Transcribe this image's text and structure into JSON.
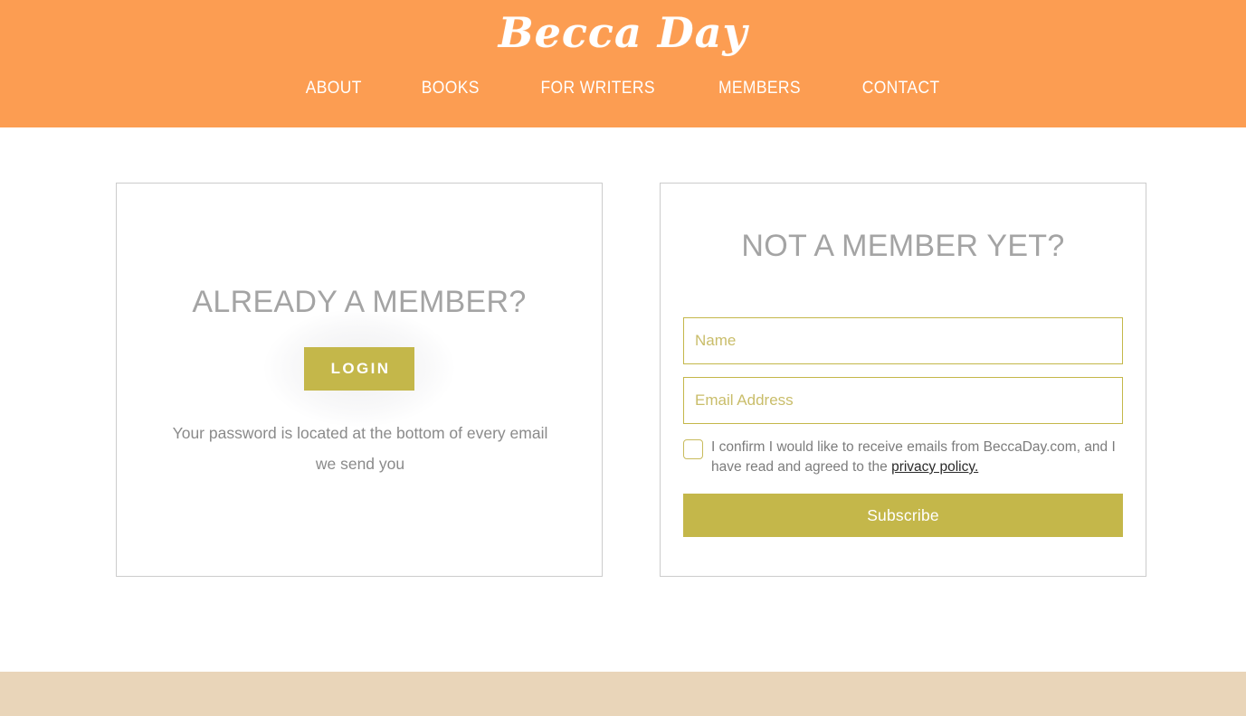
{
  "header": {
    "logo_text": "Becca Day",
    "background_color": "#FC9D52",
    "nav": [
      {
        "label": "ABOUT"
      },
      {
        "label": "BOOKS"
      },
      {
        "label": "FOR WRITERS"
      },
      {
        "label": "MEMBERS"
      },
      {
        "label": "CONTACT"
      }
    ]
  },
  "login_card": {
    "heading": "ALREADY A MEMBER?",
    "login_button_label": "LOGIN",
    "note": "Your password is located at the bottom of every email we send you"
  },
  "signup_card": {
    "heading": "NOT A MEMBER YET?",
    "name_placeholder": "Name",
    "name_value": "",
    "email_placeholder": "Email Address",
    "email_value": "",
    "consent_text_before": "I confirm I would like to receive emails from BeccaDay.com, and I have read and agreed to the ",
    "consent_link_text": "privacy policy.",
    "consent_checked": false,
    "subscribe_button_label": "Subscribe"
  },
  "colors": {
    "header_orange": "#FC9D52",
    "accent_gold": "#C4B74A",
    "footer_tan": "#E9D5B9",
    "heading_gray": "#A4A4A4",
    "body_gray": "#8A8A8A",
    "card_border": "#CCCCCC"
  }
}
